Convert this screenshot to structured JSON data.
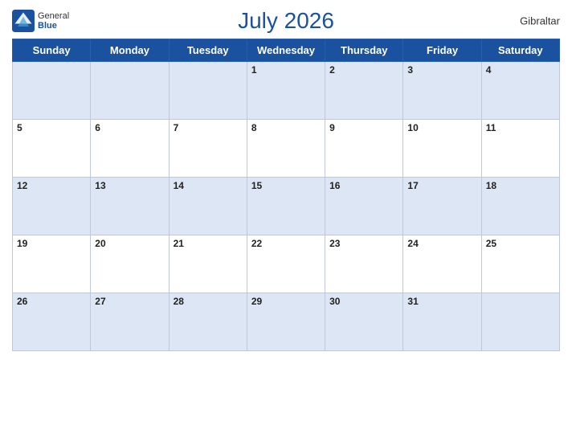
{
  "header": {
    "title": "July 2026",
    "country": "Gibraltar",
    "logo": {
      "general": "General",
      "blue": "Blue"
    }
  },
  "weekdays": [
    "Sunday",
    "Monday",
    "Tuesday",
    "Wednesday",
    "Thursday",
    "Friday",
    "Saturday"
  ],
  "weeks": [
    [
      null,
      null,
      null,
      1,
      2,
      3,
      4
    ],
    [
      5,
      6,
      7,
      8,
      9,
      10,
      11
    ],
    [
      12,
      13,
      14,
      15,
      16,
      17,
      18
    ],
    [
      19,
      20,
      21,
      22,
      23,
      24,
      25
    ],
    [
      26,
      27,
      28,
      29,
      30,
      31,
      null
    ]
  ]
}
